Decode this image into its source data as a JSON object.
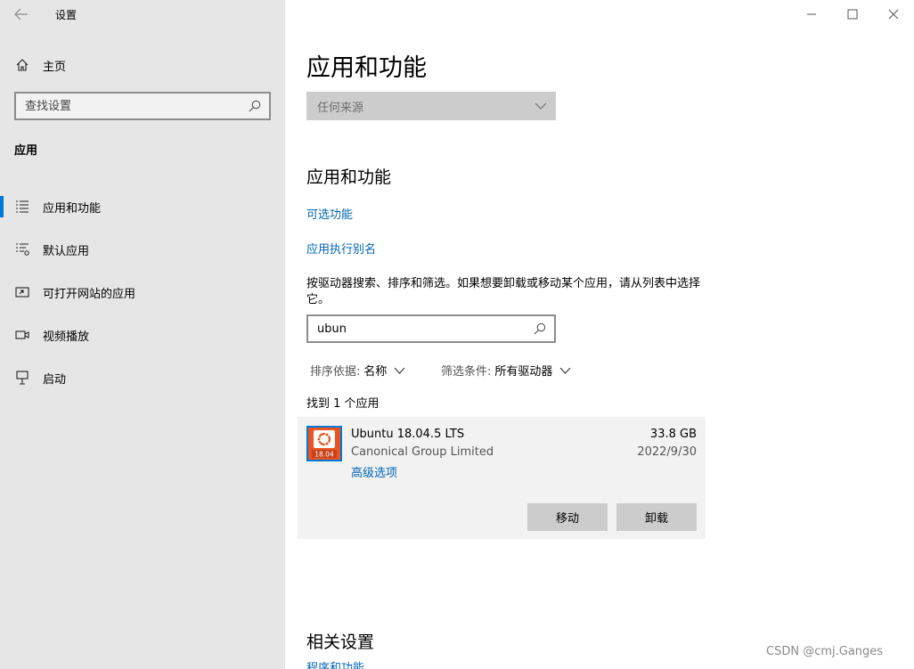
{
  "window": {
    "title": "设置"
  },
  "sidebar": {
    "home_label": "主页",
    "search_placeholder": "查找设置",
    "section_title": "应用",
    "items": [
      {
        "label": "应用和功能",
        "icon": "apps-features-icon",
        "active": true
      },
      {
        "label": "默认应用",
        "icon": "default-apps-icon",
        "active": false
      },
      {
        "label": "可打开网站的应用",
        "icon": "apps-for-websites-icon",
        "active": false
      },
      {
        "label": "视频播放",
        "icon": "video-playback-icon",
        "active": false
      },
      {
        "label": "启动",
        "icon": "startup-icon",
        "active": false
      }
    ]
  },
  "main": {
    "page_title": "应用和功能",
    "source_select": {
      "value": "任何来源"
    },
    "section_title": "应用和功能",
    "links": {
      "optional_features": "可选功能",
      "execution_aliases": "应用执行别名"
    },
    "description": "按驱动器搜索、排序和筛选。如果想要卸载或移动某个应用，请从列表中选择它。",
    "search": {
      "value": "ubun"
    },
    "sort": {
      "label": "排序依据:",
      "value": "名称"
    },
    "filter": {
      "label": "筛选条件:",
      "value": "所有驱动器"
    },
    "found_text": "找到 1 个应用",
    "app": {
      "icon_badge": "18.04",
      "name": "Ubuntu 18.04.5 LTS",
      "publisher": "Canonical Group Limited",
      "advanced_link": "高级选项",
      "size": "33.8 GB",
      "date": "2022/9/30",
      "move_button": "移动",
      "uninstall_button": "卸载"
    },
    "related_title": "相关设置",
    "related_link": "程序和功能"
  },
  "watermark": "CSDN @cmj.Ganges",
  "colors": {
    "accent": "#0078d7",
    "link": "#0066b4",
    "sidebar_bg": "#e6e6e6",
    "ubuntu_orange": "#e95420"
  }
}
